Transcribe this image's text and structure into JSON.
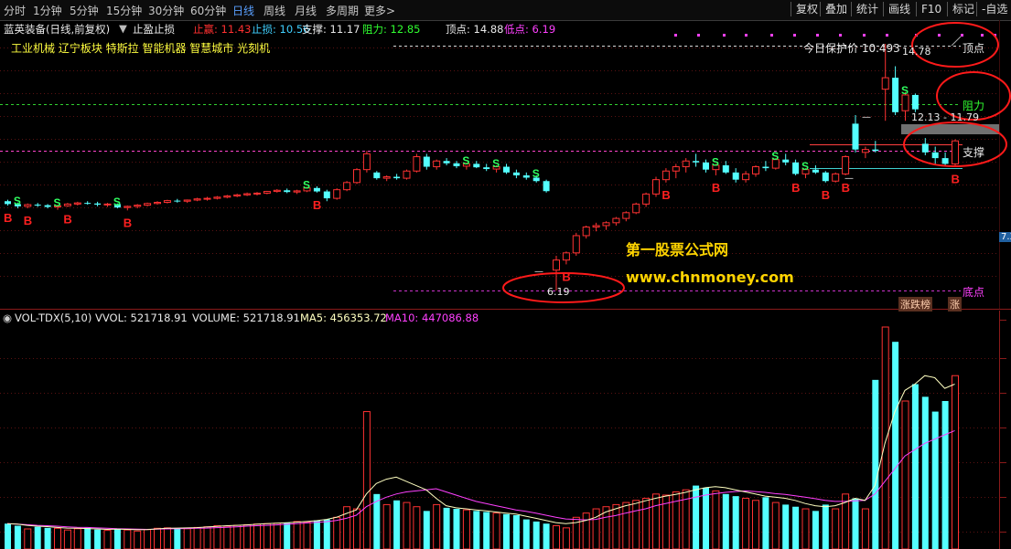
{
  "periods": [
    {
      "label": "分时",
      "active": false
    },
    {
      "label": "1分钟",
      "active": false
    },
    {
      "label": "5分钟",
      "active": false
    },
    {
      "label": "15分钟",
      "active": false
    },
    {
      "label": "30分钟",
      "active": false
    },
    {
      "label": "60分钟",
      "active": false
    },
    {
      "label": "日线",
      "active": true
    },
    {
      "label": "周线",
      "active": false
    },
    {
      "label": "月线",
      "active": false
    },
    {
      "label": "多周期",
      "active": false
    },
    {
      "label": "更多>",
      "active": false
    }
  ],
  "right_buttons": [
    "复权",
    "叠加",
    "统计",
    "画线",
    "F10",
    "标记",
    "-自选"
  ],
  "info": {
    "stock": "蓝英装备(日线,前复权)",
    "indicator": "止盈止损",
    "items": [
      {
        "label": "止赢: 11.43",
        "color": "#ff3030"
      },
      {
        "label": "止损: 10.56",
        "color": "#40d0ff"
      },
      {
        "label": "支撑: 11.17",
        "color": "#e8e8e8"
      },
      {
        "label": "阻力: 12.85",
        "color": "#30ff30"
      },
      {
        "label": "顶点: 14.88",
        "color": "#e8e8e8"
      },
      {
        "label": "低点: 6.19",
        "color": "#ff40ff"
      }
    ]
  },
  "sectors": "工业机械 辽宁板块 特斯拉 智能机器 智慧城市 光刻机",
  "labels": {
    "protect_price": "今日保护价 10.493",
    "top_point": "顶点",
    "resistance": "阻力",
    "support": "支撑",
    "bottom": "底点",
    "peak_value": "14.78",
    "range_value": "12.13 - 11.79",
    "low_value": "6.19",
    "right_price": "7.3",
    "board_tag": "涨跌榜",
    "board_zhang": "涨",
    "dash": "—"
  },
  "volume_header": {
    "name": "VOL-TDX(5,10)",
    "vvol": "VVOL: 521718.91",
    "volume": "VOLUME: 521718.91",
    "ma5": "MA5: 456353.72",
    "ma10": "MA10: 447086.88"
  },
  "watermark": {
    "line1": "第一股票公式网",
    "line2": "www.chnmoney.com"
  },
  "colors": {
    "up": "#ff3232",
    "down": "#54ffff",
    "ma5": "#ffffc0",
    "ma10": "#ff40ff",
    "support_line": "#ff44cc",
    "resistance_line": "#30d030",
    "bottom_line": "#cc33cc",
    "annotation": "#ff1a1a"
  },
  "chart_data": {
    "type": "candlestick",
    "sell_signal": "S",
    "buy_signal": "B",
    "candles": [
      [
        9.3,
        9.35,
        9.15,
        9.2
      ],
      [
        9.2,
        9.25,
        9.05,
        9.12
      ],
      [
        9.12,
        9.22,
        9.05,
        9.18
      ],
      [
        9.18,
        9.24,
        9.1,
        9.16
      ],
      [
        9.16,
        9.2,
        9.05,
        9.1
      ],
      [
        9.1,
        9.18,
        9.0,
        9.14
      ],
      [
        9.14,
        9.24,
        9.1,
        9.2
      ],
      [
        9.2,
        9.28,
        9.15,
        9.24
      ],
      [
        9.24,
        9.3,
        9.18,
        9.22
      ],
      [
        9.22,
        9.28,
        9.12,
        9.18
      ],
      [
        9.18,
        9.24,
        9.1,
        9.2
      ],
      [
        9.2,
        9.22,
        9.05,
        9.08
      ],
      [
        9.08,
        9.15,
        8.98,
        9.12
      ],
      [
        9.12,
        9.2,
        9.05,
        9.16
      ],
      [
        9.16,
        9.25,
        9.12,
        9.22
      ],
      [
        9.22,
        9.3,
        9.18,
        9.26
      ],
      [
        9.26,
        9.35,
        9.22,
        9.32
      ],
      [
        9.32,
        9.38,
        9.25,
        9.3
      ],
      [
        9.3,
        9.36,
        9.24,
        9.34
      ],
      [
        9.34,
        9.42,
        9.3,
        9.38
      ],
      [
        9.38,
        9.45,
        9.32,
        9.4
      ],
      [
        9.4,
        9.48,
        9.36,
        9.44
      ],
      [
        9.44,
        9.52,
        9.4,
        9.48
      ],
      [
        9.48,
        9.56,
        9.44,
        9.52
      ],
      [
        9.52,
        9.6,
        9.48,
        9.56
      ],
      [
        9.56,
        9.62,
        9.5,
        9.58
      ],
      [
        9.58,
        9.66,
        9.54,
        9.64
      ],
      [
        9.64,
        9.72,
        9.6,
        9.68
      ],
      [
        9.68,
        9.74,
        9.58,
        9.62
      ],
      [
        9.62,
        9.7,
        9.55,
        9.66
      ],
      [
        9.66,
        9.8,
        9.62,
        9.76
      ],
      [
        9.76,
        9.82,
        9.6,
        9.64
      ],
      [
        9.64,
        9.7,
        9.3,
        9.4
      ],
      [
        9.4,
        9.75,
        9.35,
        9.7
      ],
      [
        9.7,
        10.0,
        9.65,
        9.95
      ],
      [
        9.95,
        10.45,
        9.9,
        10.4
      ],
      [
        10.4,
        11.05,
        10.3,
        10.95
      ],
      [
        10.3,
        10.35,
        10.05,
        10.1
      ],
      [
        10.1,
        10.2,
        10.0,
        10.15
      ],
      [
        10.15,
        10.25,
        10.05,
        10.1
      ],
      [
        10.1,
        10.4,
        10.05,
        10.35
      ],
      [
        10.35,
        10.95,
        10.3,
        10.85
      ],
      [
        10.85,
        10.95,
        10.4,
        10.5
      ],
      [
        10.5,
        10.75,
        10.4,
        10.7
      ],
      [
        10.7,
        10.8,
        10.55,
        10.62
      ],
      [
        10.62,
        10.7,
        10.45,
        10.52
      ],
      [
        10.52,
        10.65,
        10.4,
        10.6
      ],
      [
        10.6,
        10.7,
        10.45,
        10.48
      ],
      [
        10.48,
        10.6,
        10.35,
        10.42
      ],
      [
        10.42,
        10.55,
        10.3,
        10.5
      ],
      [
        10.5,
        10.6,
        10.25,
        10.3
      ],
      [
        10.3,
        10.4,
        10.1,
        10.2
      ],
      [
        10.2,
        10.3,
        10.05,
        10.12
      ],
      [
        10.12,
        10.2,
        9.95,
        10.0
      ],
      [
        10.0,
        10.05,
        9.6,
        9.65
      ],
      [
        6.9,
        7.4,
        6.19,
        7.25
      ],
      [
        7.25,
        7.55,
        7.1,
        7.5
      ],
      [
        7.5,
        8.2,
        7.4,
        8.1
      ],
      [
        8.1,
        8.45,
        8.0,
        8.4
      ],
      [
        8.4,
        8.55,
        8.25,
        8.45
      ],
      [
        8.45,
        8.6,
        8.3,
        8.55
      ],
      [
        8.55,
        8.75,
        8.45,
        8.7
      ],
      [
        8.7,
        8.95,
        8.6,
        8.9
      ],
      [
        8.9,
        9.25,
        8.85,
        9.2
      ],
      [
        9.2,
        9.6,
        9.1,
        9.55
      ],
      [
        9.55,
        10.15,
        9.45,
        10.05
      ],
      [
        10.05,
        10.45,
        9.95,
        10.35
      ],
      [
        10.35,
        10.6,
        10.1,
        10.5
      ],
      [
        10.5,
        10.8,
        10.3,
        10.7
      ],
      [
        10.7,
        10.95,
        10.5,
        10.65
      ],
      [
        10.65,
        10.75,
        10.3,
        10.4
      ],
      [
        10.4,
        10.6,
        10.2,
        10.55
      ],
      [
        10.55,
        10.7,
        10.25,
        10.3
      ],
      [
        10.3,
        10.45,
        9.95,
        10.05
      ],
      [
        10.05,
        10.35,
        9.95,
        10.25
      ],
      [
        10.25,
        10.55,
        10.15,
        10.5
      ],
      [
        10.5,
        10.7,
        10.35,
        10.45
      ],
      [
        10.45,
        10.8,
        10.4,
        10.75
      ],
      [
        10.75,
        10.95,
        10.55,
        10.65
      ],
      [
        10.65,
        10.75,
        10.2,
        10.25
      ],
      [
        10.25,
        10.45,
        10.1,
        10.4
      ],
      [
        10.4,
        10.55,
        10.25,
        10.3
      ],
      [
        10.3,
        10.35,
        9.95,
        10.0
      ],
      [
        10.0,
        10.3,
        9.95,
        10.25
      ],
      [
        10.25,
        10.9,
        10.2,
        10.85
      ],
      [
        12.0,
        12.3,
        11.0,
        11.1
      ],
      [
        11.0,
        11.2,
        10.8,
        11.1
      ],
      [
        11.1,
        11.4,
        11.0,
        11.05
      ],
      [
        13.2,
        14.78,
        12.1,
        13.6
      ],
      [
        13.6,
        14.0,
        12.3,
        12.4
      ],
      [
        12.45,
        13.1,
        12.1,
        13.0
      ],
      [
        13.0,
        13.05,
        12.4,
        12.5
      ],
      [
        11.3,
        11.5,
        10.9,
        11.0
      ],
      [
        11.0,
        11.2,
        10.6,
        10.8
      ],
      [
        10.8,
        11.0,
        10.5,
        10.6
      ],
      [
        10.6,
        11.45,
        10.5,
        11.4
      ]
    ],
    "volume": [
      120,
      110,
      95,
      105,
      100,
      98,
      90,
      96,
      100,
      92,
      88,
      95,
      90,
      85,
      92,
      98,
      100,
      95,
      96,
      102,
      105,
      110,
      108,
      112,
      115,
      118,
      120,
      122,
      125,
      130,
      128,
      135,
      140,
      150,
      200,
      190,
      650,
      260,
      210,
      230,
      220,
      200,
      180,
      210,
      195,
      190,
      185,
      180,
      175,
      170,
      165,
      160,
      140,
      130,
      120,
      110,
      100,
      150,
      170,
      190,
      200,
      210,
      220,
      230,
      240,
      260,
      255,
      270,
      280,
      300,
      290,
      275,
      260,
      250,
      240,
      230,
      245,
      220,
      210,
      200,
      190,
      180,
      210,
      190,
      260,
      240,
      190,
      800,
      1050,
      980,
      700,
      780,
      720,
      650,
      700,
      820
    ],
    "ma5": [
      120,
      118,
      112,
      108,
      106,
      102,
      99,
      98,
      97,
      95,
      93,
      94,
      93,
      91,
      92,
      95,
      98,
      99,
      100,
      101,
      104,
      107,
      110,
      112,
      114,
      117,
      120,
      122,
      124,
      127,
      130,
      134,
      140,
      150,
      168,
      185,
      260,
      310,
      330,
      340,
      320,
      300,
      280,
      240,
      205,
      195,
      190,
      185,
      180,
      175,
      170,
      165,
      155,
      145,
      135,
      125,
      120,
      125,
      135,
      150,
      175,
      190,
      205,
      215,
      228,
      240,
      250,
      258,
      268,
      280,
      290,
      295,
      290,
      280,
      270,
      260,
      250,
      245,
      240,
      230,
      215,
      205,
      200,
      205,
      220,
      240,
      230,
      300,
      500,
      650,
      750,
      780,
      820,
      810,
      760,
      780
    ],
    "ma10": [
      120,
      118,
      115,
      112,
      110,
      108,
      105,
      103,
      102,
      100,
      98,
      96,
      95,
      94,
      93,
      94,
      95,
      96,
      97,
      98,
      99,
      101,
      103,
      105,
      108,
      110,
      112,
      114,
      117,
      120,
      123,
      126,
      129,
      135,
      145,
      160,
      200,
      225,
      245,
      260,
      270,
      275,
      280,
      285,
      270,
      255,
      240,
      225,
      215,
      205,
      195,
      185,
      178,
      170,
      160,
      150,
      142,
      140,
      138,
      140,
      150,
      158,
      170,
      180,
      190,
      205,
      215,
      225,
      235,
      245,
      255,
      262,
      268,
      272,
      275,
      272,
      268,
      262,
      258,
      252,
      245,
      238,
      230,
      225,
      225,
      228,
      230,
      260,
      320,
      380,
      440,
      470,
      500,
      520,
      540,
      560
    ]
  }
}
